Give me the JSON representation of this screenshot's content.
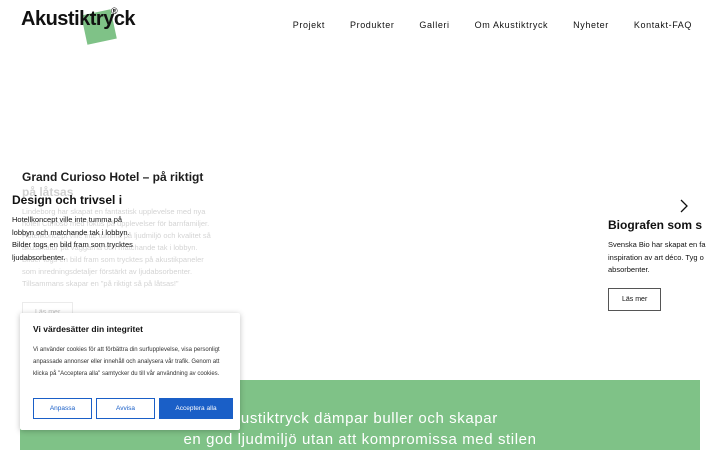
{
  "header": {
    "logo_text": "Akustiktryck",
    "logo_reg": "®",
    "nav": [
      "Projekt",
      "Produkter",
      "Galleri",
      "Om Akustiktryck",
      "Nyheter",
      "Kontakt-FAQ"
    ]
  },
  "slider": {
    "ghost": {
      "title": "Grand Curioso Hotel – på riktigt",
      "title_fade": "på låtsas",
      "text": "Lindeborg har skapat en fantastisk upplevelse med nya hotell Curioso med fokus på upplevelser för barnfamiljer. Hotellkoncept ville inte tumma på ljudmiljö och kvalitet så akustikatur på väggarna och matchande tak i lobbyn. Bilder togs en bild fram som trycktes på akustikpaneler som inredningsdetaljer förstärkt av ljudabsorbenter. Tillsammans skapar en ”på riktigt så på låtsas!”",
      "button": "Läs mer"
    },
    "main": {
      "title": "Design och trivsel i",
      "lines": [
        "Hotellkoncept ville inte tumma på",
        "lobbyn och matchande tak i lobbyn.",
        "Bilder togs en bild fram som trycktes",
        "ljudabsorbenter."
      ]
    },
    "right": {
      "title": "Biografen som s",
      "lines": [
        "Svenska Bio har skapat en fa",
        "inspiration av art déco. Tyg o",
        "absorbenter."
      ],
      "button": "Läs mer"
    }
  },
  "banner": {
    "line1": "Akustiktryck dämpar buller och skapar",
    "line2": "en god ljudmiljö utan att kompromissa med stilen"
  },
  "cookie": {
    "title": "Vi värdesätter din integritet",
    "text": "Vi använder cookies för att förbättra din surfupplevelse, visa personligt anpassade annonser eller innehåll och analysera vår trafik. Genom att klicka på \"Acceptera alla\" samtycker du till vår användning av cookies.",
    "buttons": {
      "customize": "Anpassa",
      "reject": "Avvisa",
      "accept": "Acceptera alla"
    }
  },
  "colors": {
    "green": "#7fc287",
    "blue": "#1a5fc7"
  }
}
